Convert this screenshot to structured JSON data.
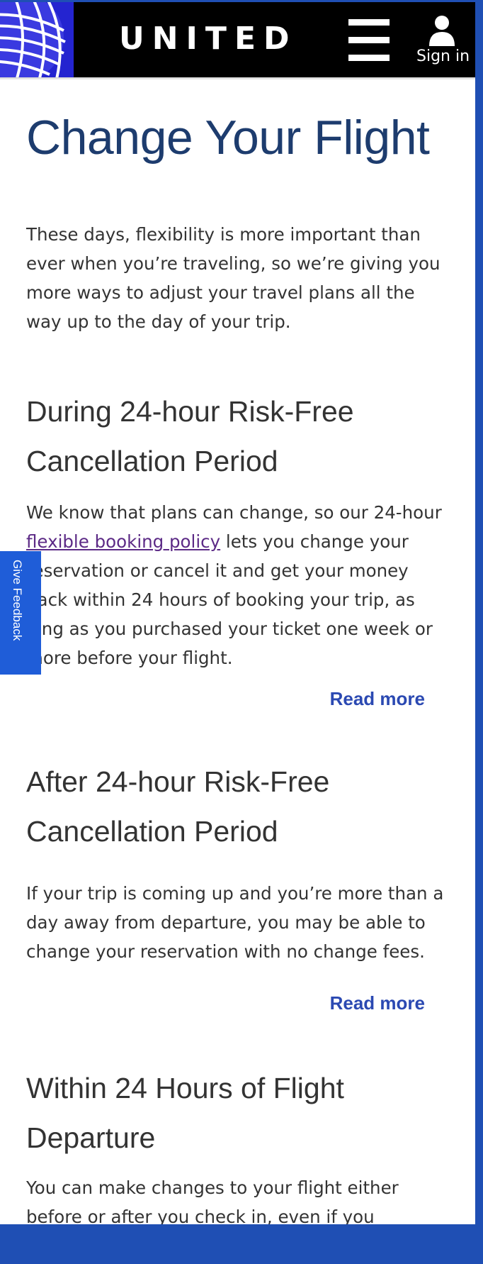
{
  "header": {
    "brand": "UNITED",
    "signin_label": "Sign in"
  },
  "page": {
    "title": "Change Your Flight",
    "intro": "These days, flexibility is more important than ever when you’re traveling, so we’re giving you more ways to adjust your travel plans all the way up to the day of your trip."
  },
  "sections": [
    {
      "title": "During 24-hour Risk-Free Cancellation Period",
      "body_before_link": "We know that plans can change, so our 24-hour ",
      "link_text": "flexible booking policy",
      "body_after_link": " lets you change your reservation or cancel it and get your money back within 24 hours of booking your trip, as long as you purchased your ticket one week or more before your flight.",
      "read_more": "Read more"
    },
    {
      "title": "After 24-hour Risk-Free Cancellation Period",
      "body": "If your trip is coming up and you’re more than a day away from departure, you may be able to change your reservation with no change fees.",
      "read_more": "Read more"
    },
    {
      "title": "Within 24 Hours of Flight Departure",
      "body": "You can make changes to your flight either before or after you check in, even if you"
    }
  ],
  "feedback_tab": "Give Feedback",
  "colors": {
    "title": "#1d3c6e",
    "link_read_more": "#2b49b2",
    "feedback_tab": "#1f5dd8",
    "frame": "#1f4fb4"
  },
  "icons": {
    "logo": "united-globe-icon",
    "menu": "hamburger-menu-icon",
    "account": "person-icon"
  }
}
